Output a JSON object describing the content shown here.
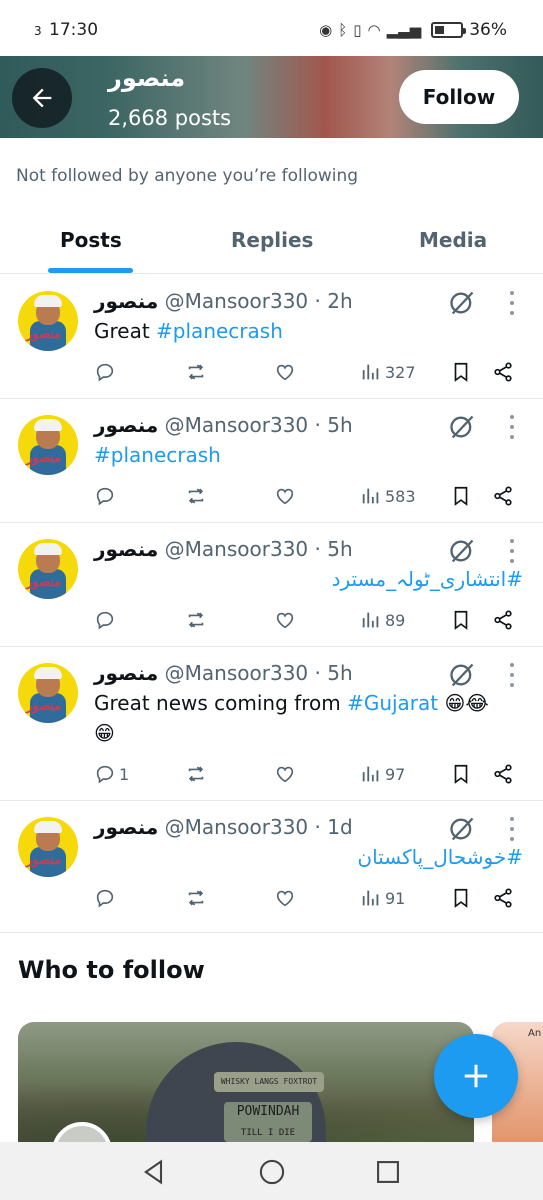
{
  "status_bar": {
    "notification_count": "3",
    "time": "17:30",
    "battery": "36%",
    "battery_level": 0.36
  },
  "header": {
    "name": "منصور",
    "post_count": "2,668 posts",
    "follow_label": "Follow"
  },
  "not_followed_text": "Not followed by anyone you’re following",
  "tabs": [
    {
      "label": "Posts",
      "active": true
    },
    {
      "label": "Replies",
      "active": false
    },
    {
      "label": "Media",
      "active": false
    }
  ],
  "posts": [
    {
      "name": "منصور",
      "handle": "@Mansoor330 · 2h",
      "text_plain": "Great ",
      "hashtag": "#planecrash",
      "reply_count": "",
      "views": "327"
    },
    {
      "name": "منصور",
      "handle": "@Mansoor330 · 5h",
      "text_plain": "",
      "hashtag": "#planecrash",
      "reply_count": "",
      "views": "583"
    },
    {
      "name": "منصور",
      "handle": "@Mansoor330 · 5h",
      "text_plain": "",
      "hashtag": "#انتشاری_ٹولہ_مسترد",
      "reply_count": "",
      "views": "89"
    },
    {
      "name": "منصور",
      "handle": "@Mansoor330 · 5h",
      "text_plain": "Great news coming from ",
      "hashtag": "#Gujarat",
      "emoji_line1": " 😁😂",
      "emoji_line2": "😁",
      "reply_count": "1",
      "views": "97"
    },
    {
      "name": "منصور",
      "handle": "@Mansoor330 · 1d",
      "text_plain": "",
      "hashtag": "#خوشحال_پاکستان",
      "reply_count": "",
      "views": "91"
    }
  ],
  "who_to_follow": {
    "title": "Who to follow",
    "card1_patch_top": "WHISKY LANGS FOXTROT",
    "card1_patch_main": "POWINDAH",
    "card1_patch_sub": "TILL I DIE",
    "card2_label": "An"
  },
  "colors": {
    "accent": "#1d9bf0",
    "text_primary": "#0f1419",
    "text_secondary": "#536471"
  }
}
